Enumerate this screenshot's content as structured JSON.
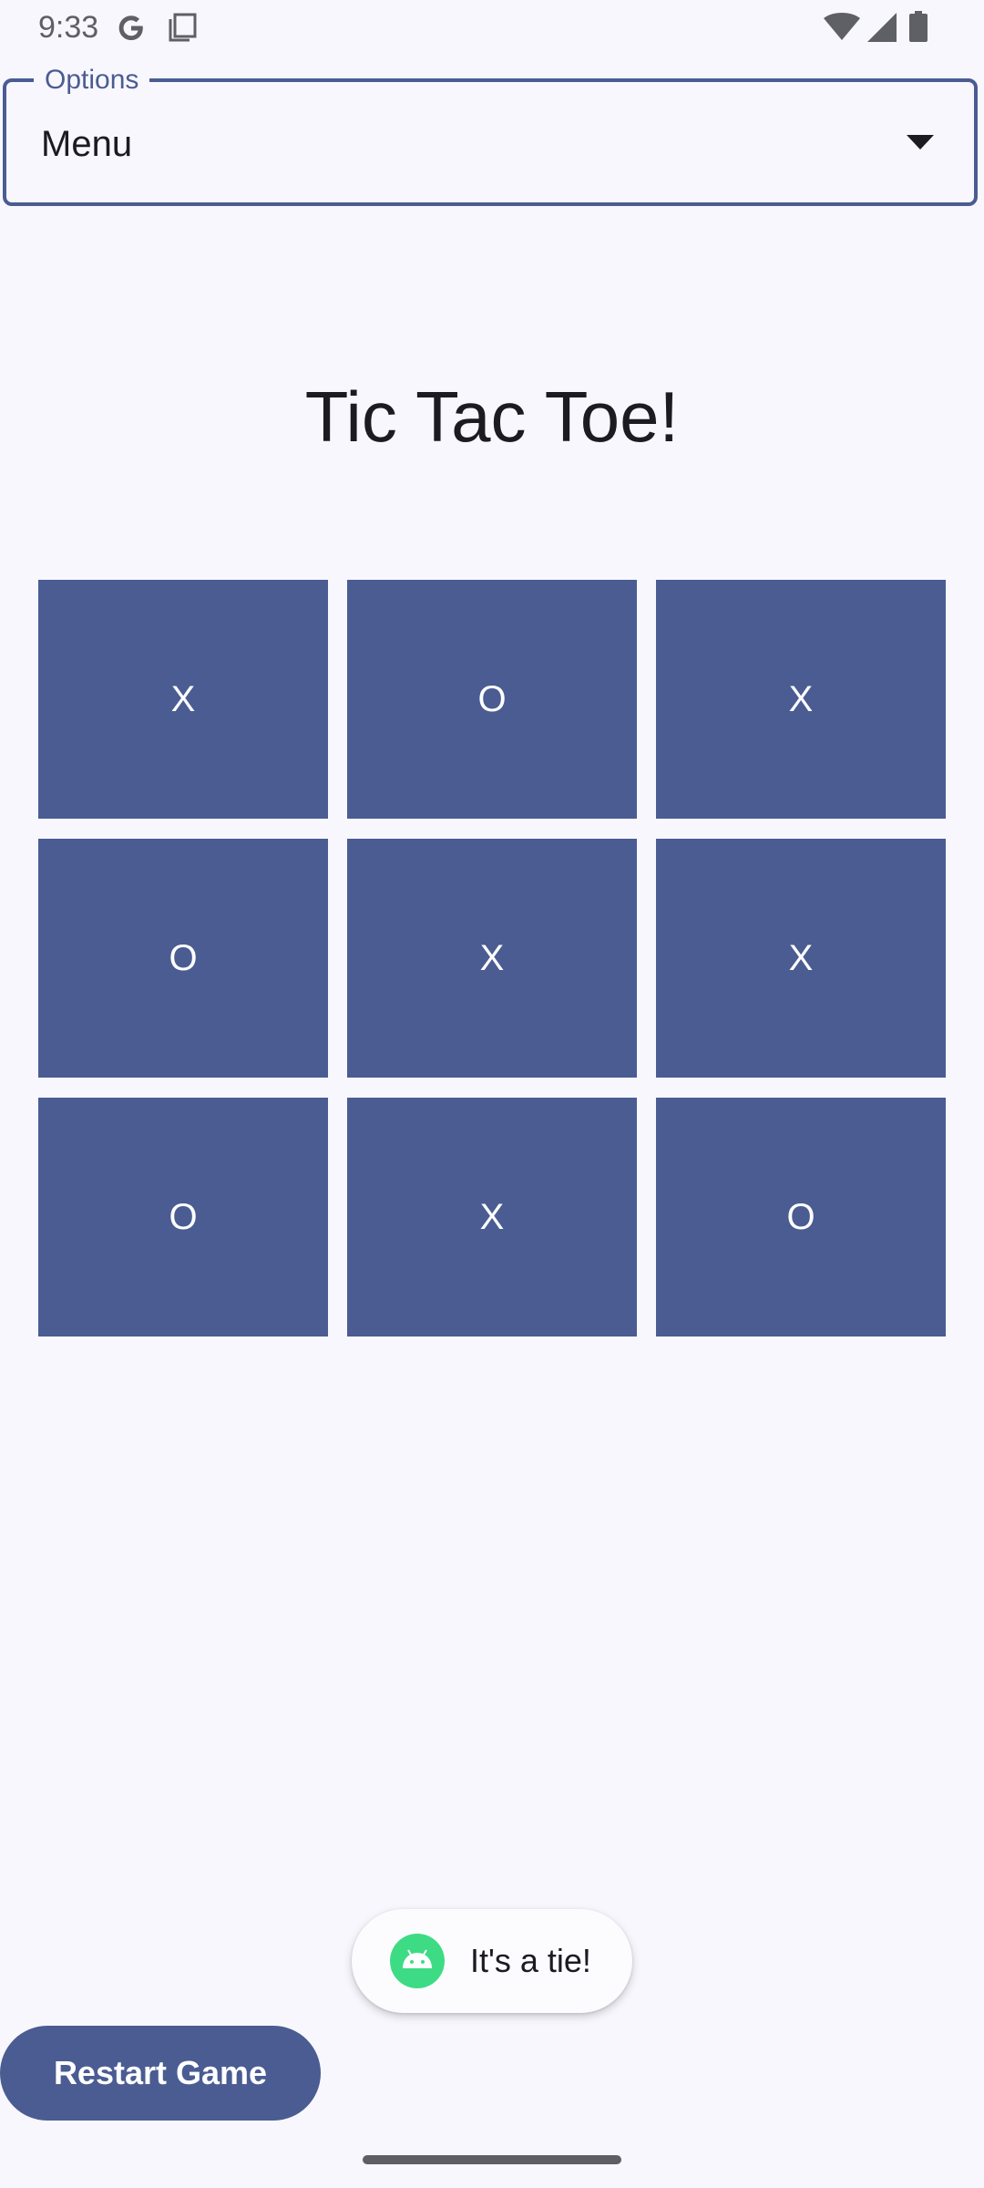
{
  "status_bar": {
    "time": "9:33",
    "icons": [
      "google-icon",
      "screenshot-icon",
      "wifi-icon",
      "cellular-signal-icon",
      "battery-icon"
    ]
  },
  "options": {
    "label": "Options",
    "selected": "Menu"
  },
  "title": "Tic Tac Toe!",
  "board": {
    "cells": [
      "X",
      "O",
      "X",
      "O",
      "X",
      "X",
      "O",
      "X",
      "O"
    ]
  },
  "toast": {
    "icon": "android-icon",
    "text": "It's a tie!"
  },
  "restart_button": {
    "label": "Restart Game"
  },
  "colors": {
    "accent": "#4A5C92",
    "background": "#F8F7FD",
    "toast_icon": "#3DDC84"
  }
}
